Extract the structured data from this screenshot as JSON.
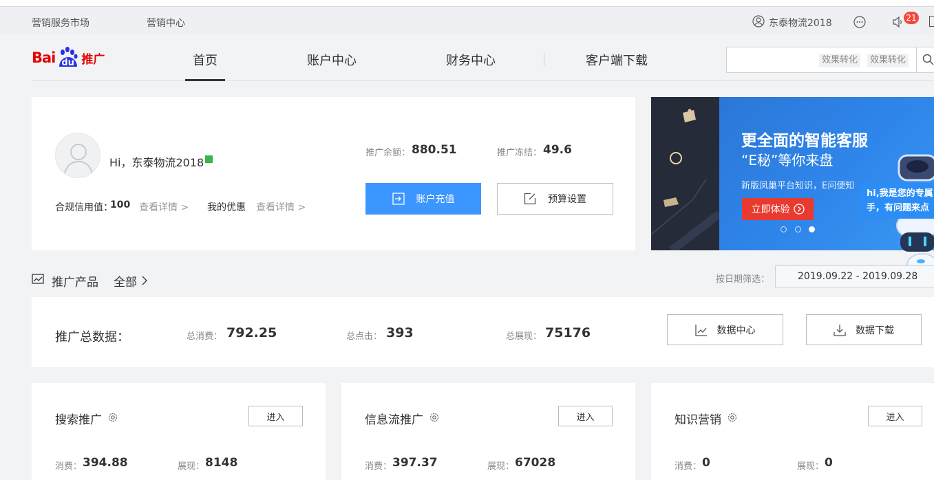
{
  "topbar": {
    "link1": "营销服务市场",
    "link2": "营销中心",
    "username": "东泰物流2018",
    "badge_count": "21"
  },
  "logo": {
    "text_bai": "Bai",
    "text_du": "du",
    "text_tuiguang": "推广"
  },
  "nav": {
    "items": [
      "首页",
      "账户中心",
      "财务中心",
      "客户端下载"
    ]
  },
  "search": {
    "tag1": "效果转化",
    "tag2": "效果转化",
    "value": ""
  },
  "account": {
    "greeting": "Hi，东泰物流2018",
    "credit_label": "合规信用值：",
    "credit_value": "100",
    "credit_link": "查看详情 >",
    "coupon_label": "我的优惠",
    "coupon_link": "查看详情 >",
    "balance_label": "推广余额：",
    "balance_value": "880.51",
    "frozen_label": "推广冻结：",
    "frozen_value": "49.6",
    "recharge_button": "账户充值",
    "budget_button": "预算设置"
  },
  "banner": {
    "title": "更全面的智能客服",
    "subtitle": "“E秘”等你来盘",
    "desc": "新版凤巢平台知识，E问便知",
    "cta": "立即体验",
    "bubble_line1": "hi,我是您的专属",
    "bubble_line2": "手，有问题来点"
  },
  "products": {
    "title": "推广产品",
    "filter": "全部",
    "date_label": "按日期筛选：",
    "date_range": "2019.09.22 - 2019.09.28"
  },
  "totals": {
    "title": "推广总数据：",
    "spend_label": "总消费：",
    "spend_value": "792.25",
    "clicks_label": "总点击：",
    "clicks_value": "393",
    "views_label": "总展现：",
    "views_value": "75176",
    "data_center_button": "数据中心",
    "data_download_button": "数据下载"
  },
  "cards": [
    {
      "title": "搜索推广",
      "enter": "进入",
      "spend_label": "消费：",
      "spend_value": "394.88",
      "views_label": "展现：",
      "views_value": "8148"
    },
    {
      "title": "信息流推广",
      "enter": "进入",
      "spend_label": "消费：",
      "spend_value": "397.37",
      "views_label": "展现：",
      "views_value": "67028"
    },
    {
      "title": "知识营销",
      "enter": "进入",
      "spend_label": "消费：",
      "spend_value": "0",
      "views_label": "展现：",
      "views_value": "0"
    }
  ],
  "colors": {
    "brand_red": "#e10602",
    "primary_blue": "#3b96ff",
    "status_green": "#3bb44a",
    "badge_red": "#f5473b"
  }
}
